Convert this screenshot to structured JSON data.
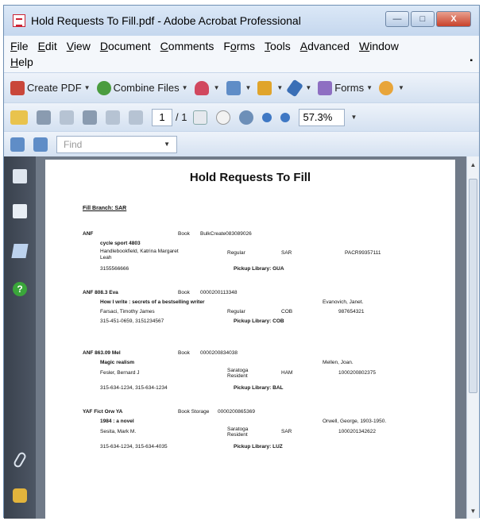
{
  "window": {
    "title": "Hold Requests To Fill.pdf - Adobe Acrobat Professional",
    "buttons": {
      "minimize": "—",
      "maximize": "□",
      "close": "X"
    }
  },
  "menubar": {
    "items": [
      {
        "accel": "F",
        "rest": "ile"
      },
      {
        "accel": "E",
        "rest": "dit"
      },
      {
        "accel": "V",
        "rest": "iew"
      },
      {
        "accel": "D",
        "rest": "ocument"
      },
      {
        "accel": "C",
        "rest": "omments"
      },
      {
        "pre": "F",
        "accel": "o",
        "rest": "rms"
      },
      {
        "accel": "T",
        "rest": "ools"
      },
      {
        "accel": "A",
        "rest": "dvanced"
      },
      {
        "accel": "W",
        "rest": "indow"
      }
    ],
    "help": {
      "accel": "H",
      "rest": "elp"
    }
  },
  "toolbar1": {
    "create_pdf": "Create PDF",
    "combine_files": "Combine Files",
    "forms": "Forms"
  },
  "toolbar2": {
    "page_current": "1",
    "page_total": "/ 1",
    "zoom": "57.3%"
  },
  "toolbar3": {
    "find_placeholder": "Find"
  },
  "document": {
    "title": "Hold Requests To Fill",
    "branch": "Fill Branch: SAR",
    "records": [
      {
        "call": "ANF",
        "type": "Book",
        "barcode": "BulkCreate083089026",
        "item_title": "cycle sport 4803",
        "author": "",
        "patron": "Handlebookfield, Katrina Margaret Leah",
        "patron_type": "Regular",
        "home": "SAR",
        "patron_id": "PACR99357111",
        "phone": "3155566666",
        "pickup": "Pickup Library: GUA"
      },
      {
        "call": "ANF 808.3 Eva",
        "type": "Book",
        "barcode": "0000200113348",
        "item_title": "How I write : secrets of a bestselling writer",
        "author": "Evanovich, Janet.",
        "patron": "Farsaci, Timothy James",
        "patron_type": "Regular",
        "home": "COB",
        "patron_id": "987654321",
        "phone": "315-451-0659, 3151234567",
        "pickup": "Pickup Library: COB"
      },
      {
        "call": "ANF 863.09 Mel",
        "type": "Book",
        "barcode": "0000200834038",
        "item_title": "Magic realism",
        "author": "Mellen, Joan.",
        "patron": "Fesler, Bernard J",
        "patron_type": "Saratoga Resident",
        "home": "HAM",
        "patron_id": "1000200802375",
        "phone": "315-634-1234, 315-634-1234",
        "pickup": "Pickup Library: BAL"
      },
      {
        "call": "YAF Fict Orw YA",
        "type": "Book Storage",
        "barcode": "0000200865369",
        "item_title": "1984 : a novel",
        "author": "Orwell, George, 1903-1950.",
        "patron": "Sesita, Mark M.",
        "patron_type": "Saratoga Resident",
        "home": "SAR",
        "patron_id": "1000201342622",
        "phone": "315-634-1234, 315-634-4035",
        "pickup": "Pickup Library: LUZ"
      }
    ]
  }
}
